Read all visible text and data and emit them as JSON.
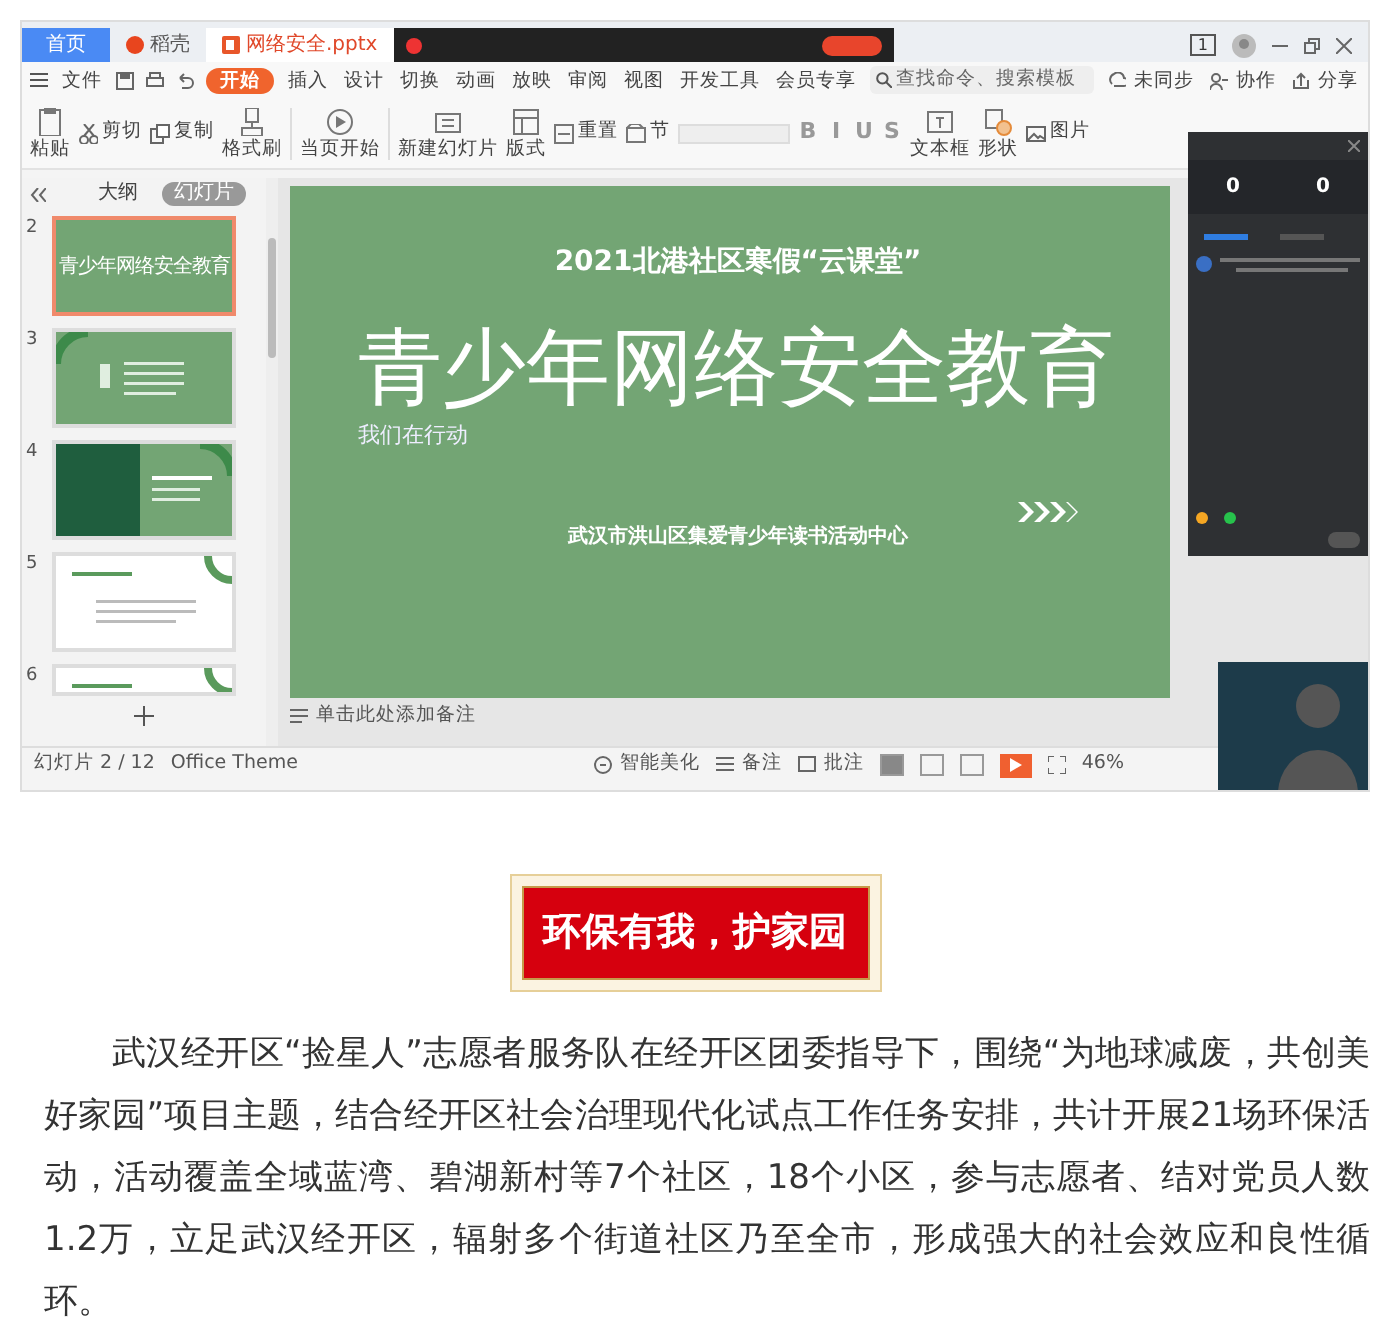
{
  "app_window": {
    "tabs": [
      {
        "label": "首页",
        "kind": "home",
        "selected": false
      },
      {
        "label": "稻壳",
        "kind": "docer",
        "selected": false
      },
      {
        "label": "网络安全.pptx",
        "kind": "file",
        "selected": true
      }
    ],
    "window_badge": "1",
    "menu": [
      {
        "label": "文件",
        "selected": false
      },
      {
        "label": "开始",
        "selected": true
      },
      {
        "label": "插入",
        "selected": false
      },
      {
        "label": "设计",
        "selected": false
      },
      {
        "label": "切换",
        "selected": false
      },
      {
        "label": "动画",
        "selected": false
      },
      {
        "label": "放映",
        "selected": false
      },
      {
        "label": "审阅",
        "selected": false
      },
      {
        "label": "视图",
        "selected": false
      },
      {
        "label": "开发工具",
        "selected": false
      },
      {
        "label": "会员专享",
        "selected": false
      }
    ],
    "search": {
      "placeholder": "查找命令、搜索模板"
    },
    "account_actions": [
      "未同步",
      "协作",
      "分享"
    ],
    "ribbon": [
      {
        "label": "粘贴",
        "kind": "large"
      },
      {
        "label": "剪切",
        "kind": "small"
      },
      {
        "label": "复制",
        "kind": "small"
      },
      {
        "label": "格式刷",
        "kind": "large"
      },
      {
        "label": "当页开始",
        "kind": "large"
      },
      {
        "label": "新建幻灯片",
        "kind": "large"
      },
      {
        "label": "版式",
        "kind": "large"
      },
      {
        "label": "重置",
        "kind": "small"
      },
      {
        "label": "节",
        "kind": "small"
      },
      {
        "label": "B",
        "kind": "format"
      },
      {
        "label": "I",
        "kind": "format"
      },
      {
        "label": "U",
        "kind": "format"
      },
      {
        "label": "S",
        "kind": "format"
      },
      {
        "label": "文本框",
        "kind": "large"
      },
      {
        "label": "形状",
        "kind": "large"
      },
      {
        "label": "图片",
        "kind": "small"
      }
    ],
    "panel_tabs": [
      {
        "label": "大纲",
        "selected": false
      },
      {
        "label": "幻灯片",
        "selected": true
      }
    ],
    "thumbnails": [
      {
        "number": "2",
        "kind": "title",
        "selected": true,
        "title": "青少年网络安全教育"
      },
      {
        "number": "3",
        "kind": "agenda",
        "selected": false
      },
      {
        "number": "4",
        "kind": "split",
        "selected": false
      },
      {
        "number": "5",
        "kind": "white",
        "selected": false
      },
      {
        "number": "6",
        "kind": "white",
        "selected": false
      }
    ],
    "slide": {
      "kicker": "2021北港社区寒假“云课堂”",
      "title": "青少年网络安全教育",
      "tagline": "我们在行动",
      "organizer": "武汉市洪山区集爱青少年读书活动中心"
    },
    "notes_placeholder": "单击此处添加备注",
    "live_panel": {
      "stats": [
        "0",
        "0"
      ],
      "tabs": [
        {
          "selected": true
        },
        {
          "selected": false
        }
      ],
      "badges": [
        {
          "color": "#f5a623"
        },
        {
          "color": "#27c24c"
        }
      ]
    },
    "status_bar": {
      "slide_counter": "幻灯片 2 / 12",
      "theme": "Office Theme",
      "tools": [
        "智能美化",
        "备注",
        "批注"
      ],
      "views": [
        {
          "selected": true
        },
        {
          "selected": false
        },
        {
          "selected": false
        }
      ],
      "zoom": "46%"
    }
  },
  "article": {
    "heading": "环保有我，护家园",
    "paragraph": "武汉经开区“捡星人”志愿者服务队在经开区团委指导下，围绕“为地球减废，共创美好家园”项目主题，结合经开区社会治理现代化试点工作任务安排，共计开展21场环保活动，活动覆盖全域蓝湾、碧湖新村等7个社区，18个小区，参与志愿者、结对党员人数1.2万，立足武汉经开区，辐射多个街道社区乃至全市，形成强大的社会效应和良性循环。"
  }
}
